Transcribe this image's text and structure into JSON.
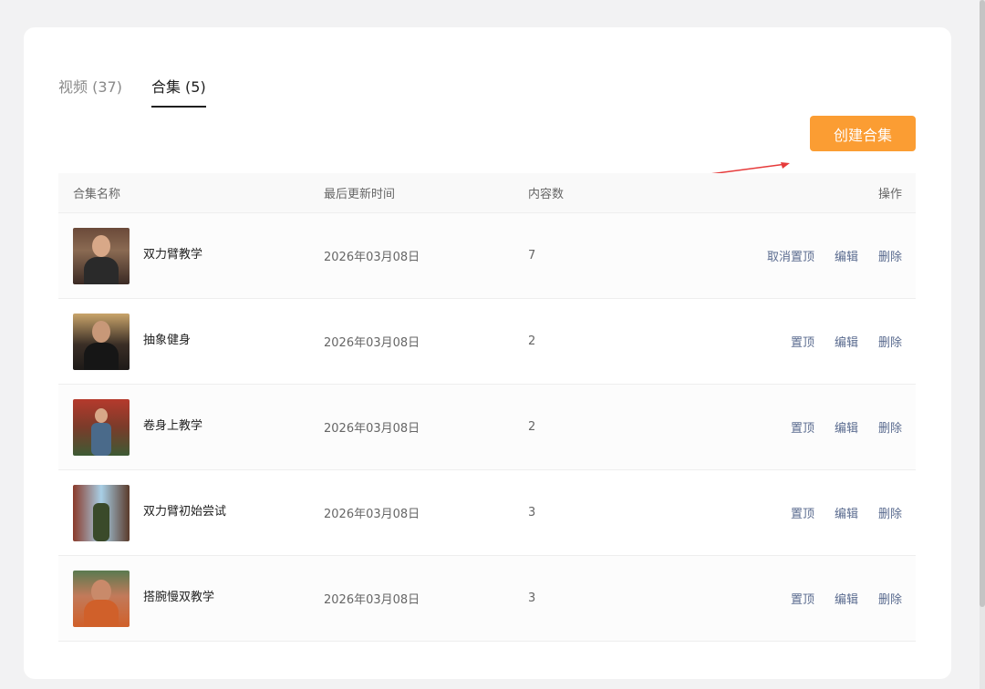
{
  "tabs": [
    {
      "label": "视频 (37)",
      "active": false
    },
    {
      "label": "合集 (5)",
      "active": true
    }
  ],
  "create_button": "创建合集",
  "table": {
    "headers": {
      "name": "合集名称",
      "updated": "最后更新时间",
      "count": "内容数",
      "actions": "操作"
    },
    "rows": [
      {
        "title": "双力臂教学",
        "updated": "2026年03月08日",
        "count": "7",
        "ops": [
          "取消置顶",
          "编辑",
          "删除"
        ]
      },
      {
        "title": "抽象健身",
        "updated": "2026年03月08日",
        "count": "2",
        "ops": [
          "置顶",
          "编辑",
          "删除"
        ]
      },
      {
        "title": "卷身上教学",
        "updated": "2026年03月08日",
        "count": "2",
        "ops": [
          "置顶",
          "编辑",
          "删除"
        ]
      },
      {
        "title": "双力臂初始尝试",
        "updated": "2026年03月08日",
        "count": "3",
        "ops": [
          "置顶",
          "编辑",
          "删除"
        ]
      },
      {
        "title": "搭腕慢双教学",
        "updated": "2026年03月08日",
        "count": "3",
        "ops": [
          "置顶",
          "编辑",
          "删除"
        ]
      }
    ]
  },
  "colors": {
    "accent_button": "#fb9d33",
    "link": "#5a6b8f",
    "annotation_arrow": "#e63b3b"
  }
}
